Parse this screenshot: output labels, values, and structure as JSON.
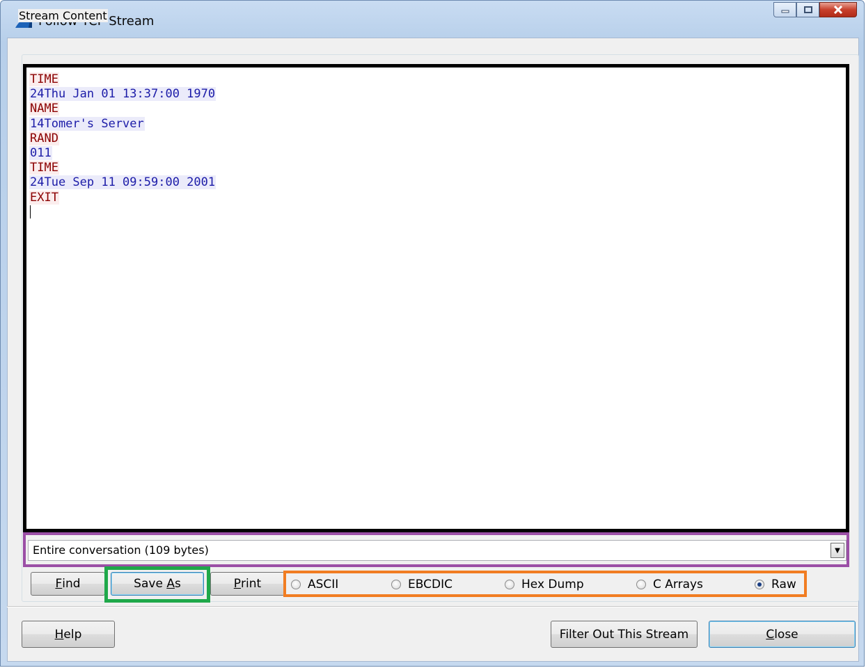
{
  "window": {
    "title": "Follow TCP Stream"
  },
  "group": {
    "label": "Stream Content"
  },
  "stream_lines": [
    {
      "text": "TIME",
      "side": "client"
    },
    {
      "text": "24Thu Jan 01 13:37:00 1970",
      "side": "server"
    },
    {
      "text": "NAME",
      "side": "client"
    },
    {
      "text": "14Tomer's Server",
      "side": "server"
    },
    {
      "text": "RAND",
      "side": "client"
    },
    {
      "text": "011",
      "side": "server"
    },
    {
      "text": "TIME",
      "side": "client"
    },
    {
      "text": "24Tue Sep 11 09:59:00 2001",
      "side": "server"
    },
    {
      "text": "EXIT",
      "side": "client"
    }
  ],
  "conversation_select": {
    "value": "Entire conversation (109 bytes)"
  },
  "buttons": {
    "find": {
      "access": "F",
      "rest": "ind"
    },
    "save_as": {
      "pre": "Save ",
      "access": "A",
      "rest": "s"
    },
    "print": {
      "access": "P",
      "rest": "rint"
    },
    "help": {
      "access": "H",
      "rest": "elp"
    },
    "filter_out": "Filter Out This Stream",
    "close": {
      "access": "C",
      "rest": "lose"
    }
  },
  "formats": {
    "ascii": "ASCII",
    "ebcdic": "EBCDIC",
    "hex_dump": "Hex Dump",
    "c_arrays": "C Arrays",
    "raw": "Raw",
    "selected": "raw"
  },
  "colors": {
    "client_text": "#8b0000",
    "server_text": "#1c1ca8",
    "highlight_purple": "#9b4fa6",
    "highlight_green": "#1fa84a",
    "highlight_orange": "#f17d22"
  }
}
